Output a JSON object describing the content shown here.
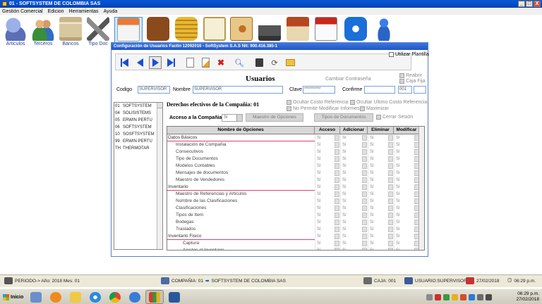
{
  "window": {
    "title": "01 - SOFTSYSTEM DE COLOMBIA SAS",
    "buttons": [
      "_",
      "□",
      "X"
    ]
  },
  "menu": [
    "Gestión Comercial",
    "Edicion",
    "Herramientas",
    "Ayuda"
  ],
  "toolbar": [
    {
      "label": "Articulos",
      "icon": "users-articles-icon"
    },
    {
      "label": "Terceros",
      "icon": "people-icon"
    },
    {
      "label": "Bancos",
      "icon": "bank-building-icon"
    },
    {
      "label": "Tipo Doc",
      "icon": "tools-icon"
    },
    {
      "label": "",
      "icon": "store-icon"
    },
    {
      "label": "",
      "icon": "briefcase-icon"
    },
    {
      "label": "",
      "icon": "coins-icon"
    },
    {
      "label": "",
      "icon": "certificate-icon"
    },
    {
      "label": "",
      "icon": "address-book-icon"
    },
    {
      "label": "",
      "icon": "printer-icon"
    },
    {
      "label": "",
      "icon": "house-icon"
    },
    {
      "label": "",
      "icon": "calendar-icon"
    },
    {
      "label": "",
      "icon": "teamviewer-icon"
    },
    {
      "label": "",
      "icon": "messenger-icon"
    }
  ],
  "child": {
    "title": "Configuración de Usuarios Factin 12092016 - SoftSystem S.A.S Nit: 900.416.385-1",
    "utilizar_plantilla": "Utilizar Plantilla",
    "heading": "Usuarios",
    "cambiar_contrasena": "Cambiar Contraseña",
    "reabrir": "Reabrir",
    "caja_fija": "Caja Fija",
    "codigo_label": "Codigo",
    "codigo_value": "SUPERVISOR",
    "nombre_label": "Nombre",
    "nombre_value": "SUPERVISOR",
    "clave_label": "Clave",
    "clave_value": "**********",
    "confirme_label": "Confirme",
    "confirme_value": "",
    "extra_value": "001",
    "derechos": "Derechos efectivos de la Compañia: 01",
    "ocultar_costo": "Ocultar Costo Referencia",
    "ocultar_ultimo": "Ocultar Ultimo Costo Referencia",
    "no_modificar": "No Permite Modificar Informes",
    "maximizar": "Maximizar",
    "acceso_label": "Acceso a la Compañia :",
    "acceso_value": "Sí",
    "maestro_opciones": "Maestro de Opciones",
    "tipos_documentos": "Tipos de Documentos",
    "cerrar_sesion": "Cerrar Sesión"
  },
  "users": [
    {
      "code": "01",
      "name": "SOFTSYSTEM"
    },
    {
      "code": "04",
      "name": "SOLISISTEMS"
    },
    {
      "code": "05",
      "name": "ERWIN PERTU"
    },
    {
      "code": "06",
      "name": "SOFTSYSTEM"
    },
    {
      "code": "10",
      "name": "SOSFTSYSTEM"
    },
    {
      "code": "99",
      "name": "ERWIN PERTU"
    },
    {
      "code": "TH",
      "name": "THERMOTAR"
    }
  ],
  "grid": {
    "headers": [
      "Nombre de Opciones",
      "Acceso",
      "Adicionar",
      "Eliminar",
      "Modificar"
    ],
    "rows": [
      {
        "level": "group",
        "name": "Datos Básicos"
      },
      {
        "level": "item",
        "name": "Instalación de Compañia"
      },
      {
        "level": "item",
        "name": "Consecutivos"
      },
      {
        "level": "item",
        "name": "Tipo de Documentos"
      },
      {
        "level": "item",
        "name": "Modelos Contables"
      },
      {
        "level": "item",
        "name": "Mensajes de documentos"
      },
      {
        "level": "item",
        "name": "Maestro de Vendedores"
      },
      {
        "level": "group",
        "name": "Inventario"
      },
      {
        "level": "item",
        "name": "Maestro de Referencias y Articulos"
      },
      {
        "level": "item",
        "name": "Nombre de las Clasificaciones"
      },
      {
        "level": "item",
        "name": "Clasificaciones"
      },
      {
        "level": "item",
        "name": "Tipos de Item"
      },
      {
        "level": "item",
        "name": "Bodegas"
      },
      {
        "level": "item",
        "name": "Traslados"
      },
      {
        "level": "group",
        "name": "Inventario Fisico"
      },
      {
        "level": "sub",
        "name": "Captura"
      },
      {
        "level": "sub",
        "name": "Ajustes al Inventario"
      }
    ],
    "cell_value": "Sí"
  },
  "status": {
    "periodo": "PERIODO-> Año: 2018  Mes: 01",
    "compania": "COMPAÑIA: 01",
    "compania_name": "SOFTSYSTEM DE COLOMBIA SAS",
    "caja": "CAJA: 001",
    "usuario": "USUARIO:SUPERVISOR",
    "fecha": "27/02/2018",
    "hora": "06:29 p.m."
  },
  "taskbar": {
    "start": "Inicio",
    "apps": [
      "explorer-icon",
      "media-player-icon",
      "folder-icon",
      "ie-icon",
      "chrome-icon",
      "network-icon",
      "excel-icon",
      "word-icon"
    ],
    "clock_time": "06:29 p.m.",
    "clock_date": "27/02/2018"
  },
  "colors": {
    "title_blue": "#0a58d8",
    "group_underline": "#e0406b",
    "nav_blue": "#1c4fd0",
    "label_blue": "#2c3f8f"
  }
}
